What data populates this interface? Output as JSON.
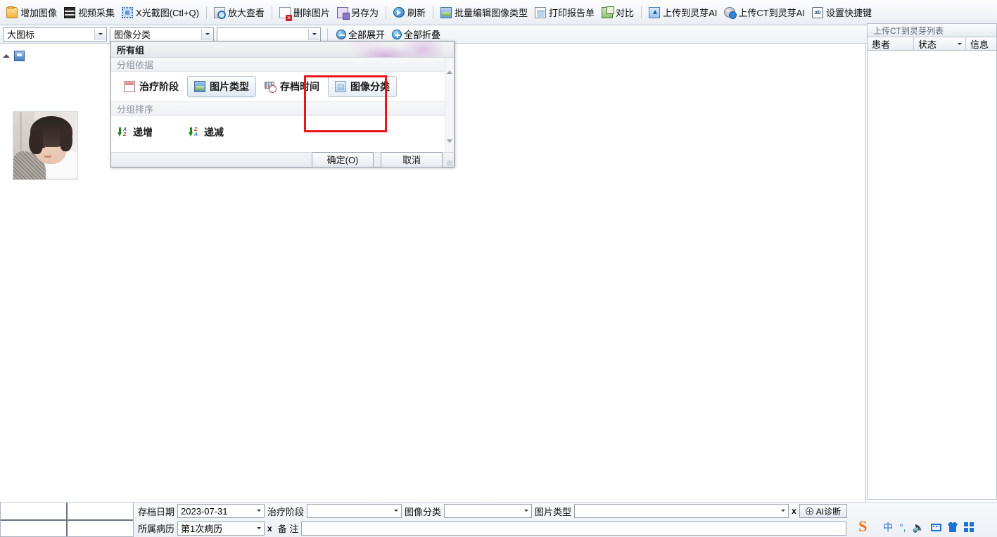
{
  "toolbar": {
    "items": [
      {
        "label": "增加图像",
        "icon": "folder-add-icon"
      },
      {
        "label": "视频采集",
        "icon": "video-capture-icon"
      },
      {
        "label": "X光截图(Ctl+Q)",
        "icon": "xray-capture-icon"
      },
      {
        "label": "放大查看",
        "icon": "zoom-view-icon"
      },
      {
        "label": "删除图片",
        "icon": "delete-image-icon"
      },
      {
        "label": "另存为",
        "icon": "save-as-icon"
      },
      {
        "label": "刷新",
        "icon": "refresh-icon"
      },
      {
        "label": "批量编辑图像类型",
        "icon": "batch-edit-icon"
      },
      {
        "label": "打印报告单",
        "icon": "print-report-icon"
      },
      {
        "label": "对比",
        "icon": "compare-icon"
      },
      {
        "label": "上传到灵芽AI",
        "icon": "upload-icon"
      },
      {
        "label": "上传CT到灵芽AI",
        "icon": "upload-ct-icon"
      },
      {
        "label": "设置快捷键",
        "icon": "ab-shortcut-icon"
      }
    ]
  },
  "filterbar": {
    "view_mode": "大图标",
    "group_by": "图像分类",
    "group_value": "",
    "expand_all": "全部展开",
    "collapse_all": "全部折叠"
  },
  "dialog": {
    "title": "所有组",
    "group_by_label": "分组依据",
    "group_by_options": [
      {
        "label": "治疗阶段",
        "icon": "calendar-icon",
        "state": "normal"
      },
      {
        "label": "图片类型",
        "icon": "picture-type-icon",
        "state": "selected"
      },
      {
        "label": "存档时间",
        "icon": "archive-clock-icon",
        "state": "normal"
      },
      {
        "label": "图像分类",
        "icon": "image-category-icon",
        "state": "highlighted"
      }
    ],
    "sort_label": "分组排序",
    "sort_options": [
      {
        "label": "递增",
        "icon": "sort-ascending-icon"
      },
      {
        "label": "递减",
        "icon": "sort-descending-icon"
      }
    ],
    "ok_label": "确定(O)",
    "cancel_label": "取消",
    "highlight_color": "#e8161a"
  },
  "content": {
    "group_collapse_icon": "chevron-up-icon",
    "group_badge_icon": "group-icon",
    "thumbnail_name": "patient-photo-thumbnail"
  },
  "right_panel": {
    "title": "上传CT到灵芽列表",
    "columns": [
      "患者",
      "状态",
      "信息"
    ],
    "rows": []
  },
  "bottom": {
    "fields": [
      {
        "label": "存档日期",
        "value": "2023-07-31",
        "type": "combo"
      },
      {
        "label": "治疗阶段",
        "value": "",
        "type": "combo"
      },
      {
        "label": "图像分类",
        "value": "",
        "type": "combo"
      },
      {
        "label": "图片类型",
        "value": "",
        "type": "combo"
      }
    ],
    "row2": [
      {
        "label": "所属病历",
        "value": "第1次病历",
        "type": "combo"
      },
      {
        "label": "备      注",
        "value": "",
        "type": "text"
      }
    ],
    "clear_label": "x",
    "ai_button": "AI诊断"
  },
  "ime": {
    "logo": "S",
    "mode": "中",
    "punctuation": "°,",
    "items": [
      "sogou-logo-icon",
      "chinese-mode-icon",
      "punctuation-icon",
      "voice-input-icon",
      "soft-keyboard-icon",
      "skin-icon",
      "toolbox-icon"
    ]
  }
}
